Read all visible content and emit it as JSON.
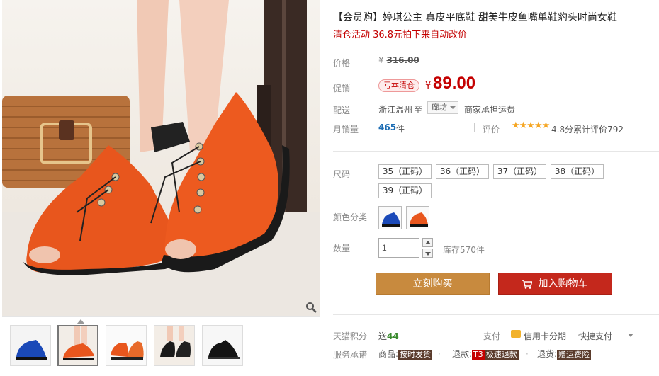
{
  "product": {
    "title": "【会员购】婷琪公主 真皮平底鞋 甜美牛皮鱼嘴单鞋豹头时尚女鞋",
    "promo_line": "清仓活动 36.8元拍下来自动改价"
  },
  "price": {
    "label": "价格",
    "currency": "¥",
    "original": "316.00",
    "promo_label": "促销",
    "promo_tag": "亏本清仓",
    "current": "89.00"
  },
  "shipping": {
    "label": "配送",
    "from": "浙江温州",
    "to_word": "至",
    "to_city": "廊坊",
    "fee": "商家承担运费"
  },
  "sales": {
    "label": "月销量",
    "count": "465",
    "unit": "件",
    "rating_label": "评价",
    "stars": "★★★★★",
    "rating_text": "4.8分累计评价792"
  },
  "size": {
    "label": "尺码",
    "options": [
      "35（正码）",
      "36（正码）",
      "37（正码）",
      "38（正码）",
      "39（正码）"
    ]
  },
  "color": {
    "label": "颜色分类",
    "options": [
      "blue-shoe",
      "orange-shoe"
    ]
  },
  "quantity": {
    "label": "数量",
    "value": "1",
    "stock": "库存570件"
  },
  "actions": {
    "buy_now": "立刻购买",
    "add_to_cart": "加入购物车"
  },
  "points": {
    "label": "天猫积分",
    "prefix": "送",
    "value": "44"
  },
  "payment": {
    "label": "支付",
    "credit": "信用卡分期",
    "quick": "快捷支付"
  },
  "services": {
    "label": "服务承诺",
    "items": [
      {
        "prefix": "商品:",
        "tag": "按时发货"
      },
      {
        "prefix": "退款:",
        "tag_brand": "T3",
        "tag": "极速退款"
      },
      {
        "prefix": "退货:",
        "tag": "赠运费险"
      }
    ]
  },
  "colors": {
    "price_red": "#c40000",
    "buy_button": "#c88a3e",
    "cart_button": "#c4281c",
    "link_blue": "#1e6eb4",
    "points_green": "#3a8a2e",
    "star": "#f5a623"
  },
  "icons": [
    "zoom-icon",
    "cart-icon",
    "card-icon",
    "stepper-up-icon",
    "stepper-down-icon",
    "dropdown-caret-icon"
  ]
}
